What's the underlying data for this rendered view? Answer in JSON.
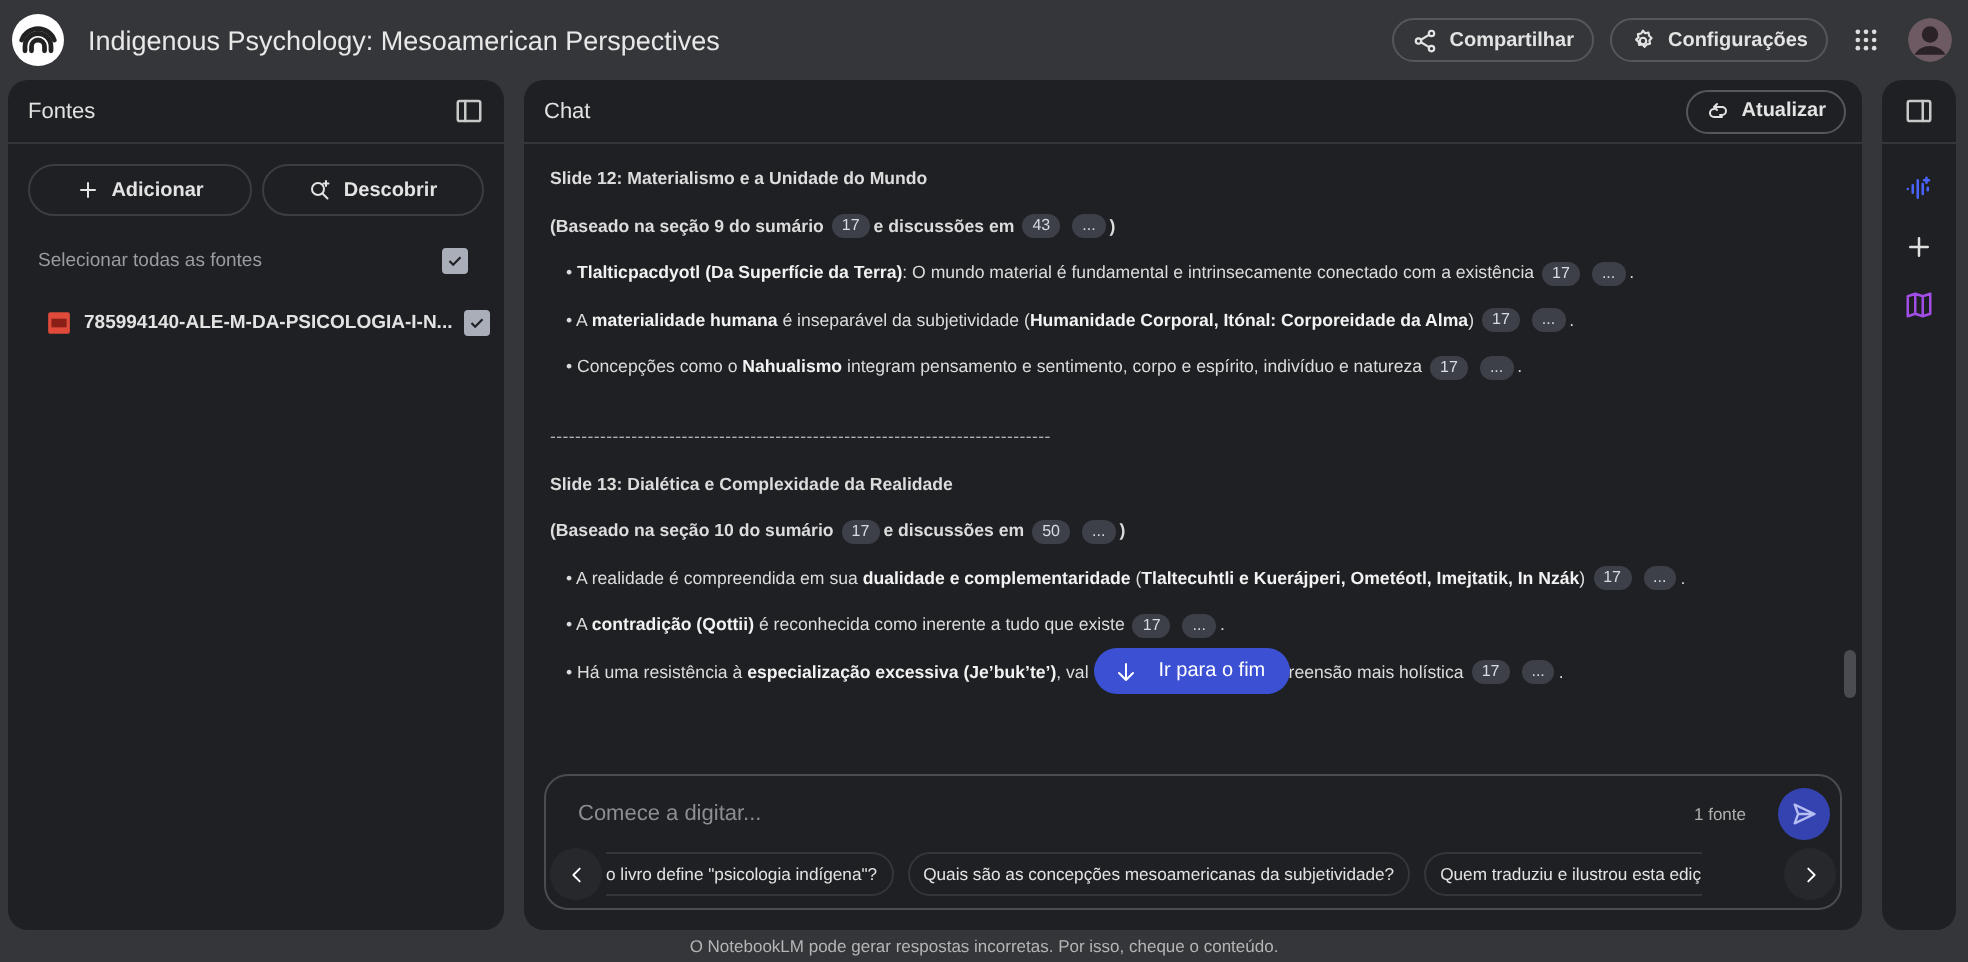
{
  "app": {
    "title": "Indigenous Psychology: Mesoamerican Perspectives"
  },
  "header_actions": [
    {
      "label": "Compartilhar"
    },
    {
      "label": "Configurações"
    }
  ],
  "sources_panel": {
    "title": "Fontes",
    "buttons": [
      {
        "label": "Adicionar"
      },
      {
        "label": "Descobrir"
      }
    ],
    "select_all": {
      "label": "Selecionar todas as fontes",
      "checked": true
    },
    "sources": [
      {
        "name": "785994140-ALE-M-DA-PSICOLOGIA-I-N...",
        "checked": true
      }
    ]
  },
  "chat": {
    "title": "Chat",
    "refresh_button": "Atualizar",
    "lines": [
      {
        "kind": "heading",
        "parts": [
          {
            "kind": "text",
            "text": "Slide 12: Materialismo e a Unidade do Mundo"
          }
        ]
      },
      {
        "kind": "note",
        "parts": [
          {
            "kind": "text",
            "text": "(Baseado na seção 9 do sumário"
          },
          {
            "kind": "cite",
            "text": "17"
          },
          {
            "kind": "text",
            "text": "e discussões em"
          },
          {
            "kind": "cite",
            "text": "43"
          },
          {
            "kind": "cite",
            "text": "..."
          },
          {
            "kind": "text",
            "text": ")"
          }
        ]
      },
      {
        "kind": "bullet",
        "parts": [
          {
            "kind": "text",
            "text": "• **Tlalticpacdyotl (Da Superfície da Terra)**: O mundo material é fundamental e intrinsecamente conectado com a existência"
          },
          {
            "kind": "cite",
            "text": "17"
          },
          {
            "kind": "cite",
            "text": "..."
          },
          {
            "kind": "text",
            "text": "."
          }
        ]
      },
      {
        "kind": "bullet",
        "parts": [
          {
            "kind": "text",
            "text": "• A **materialidade humana** é inseparável da subjetividade (**Humanidade Corporal, Itónal: Corporeidade da Alma**)"
          },
          {
            "kind": "cite",
            "text": "17"
          },
          {
            "kind": "cite",
            "text": "..."
          },
          {
            "kind": "text",
            "text": "."
          }
        ]
      },
      {
        "kind": "bullet",
        "parts": [
          {
            "kind": "text",
            "text": "• Concepções como o **Nahualismo** integram pensamento e sentimento, corpo e espírito, indivíduo e natureza"
          },
          {
            "kind": "cite",
            "text": "17"
          },
          {
            "kind": "cite",
            "text": "..."
          },
          {
            "kind": "text",
            "text": "."
          }
        ]
      },
      {
        "kind": "rule",
        "parts": [
          {
            "kind": "text",
            "text": "--------------------------------------------------------------------------------"
          }
        ]
      },
      {
        "kind": "heading",
        "parts": [
          {
            "kind": "text",
            "text": "Slide 13: Dialética e Complexidade da Realidade"
          }
        ]
      },
      {
        "kind": "note",
        "parts": [
          {
            "kind": "text",
            "text": "(Baseado na seção 10 do sumário"
          },
          {
            "kind": "cite",
            "text": "17"
          },
          {
            "kind": "text",
            "text": "e discussões em"
          },
          {
            "kind": "cite",
            "text": "50"
          },
          {
            "kind": "cite",
            "text": "..."
          },
          {
            "kind": "text",
            "text": ")"
          }
        ]
      },
      {
        "kind": "bullet",
        "parts": [
          {
            "kind": "text",
            "text": "• A realidade é compreendida em sua **dualidade e complementaridade** (**Tlaltecuhtli e Kuerájperi, Ometéotl, Imejtatik, In Nzák**)"
          },
          {
            "kind": "cite",
            "text": "17"
          },
          {
            "kind": "cite",
            "text": "..."
          },
          {
            "kind": "text",
            "text": "."
          }
        ]
      },
      {
        "kind": "bullet",
        "parts": [
          {
            "kind": "text",
            "text": "• A **contradição (Qottii)** é reconhecida como inerente a tudo que existe"
          },
          {
            "kind": "cite",
            "text": "17"
          },
          {
            "kind": "cite",
            "text": "..."
          },
          {
            "kind": "text",
            "text": "."
          }
        ]
      },
      {
        "kind": "bullet",
        "parts": [
          {
            "kind": "text",
            "text": "• Há uma resistência à **especialização excessiva (Je’buk’te’)**, val"
          },
          {
            "kind": "gap"
          },
          {
            "kind": "text",
            "text": "reensão mais holística"
          },
          {
            "kind": "cite",
            "text": "17"
          },
          {
            "kind": "cite",
            "text": "..."
          },
          {
            "kind": "text",
            "text": "."
          }
        ]
      }
    ],
    "jump_button": "Ir para o fim",
    "input": {
      "placeholder": "Comece a digitar...",
      "source_count": "1 fonte"
    },
    "suggestions": [
      "o livro define \"psicologia indígena\"?",
      "Quais são as concepções mesoamericanas da subjetividade?",
      "Quem traduziu e ilustrou esta ediç"
    ]
  },
  "footer": "O NotebookLM pode gerar respostas incorretas. Por isso, cheque o conteúdo."
}
